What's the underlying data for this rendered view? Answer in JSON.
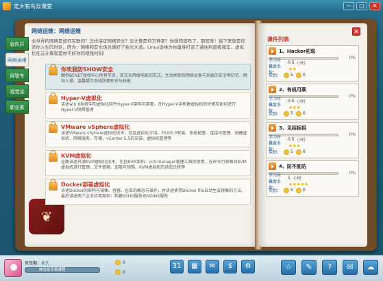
{
  "window": {
    "title": "走大有鸟云课堂",
    "buttons": [
      "—",
      "□",
      "✕"
    ]
  },
  "sidebar": {
    "tabs": [
      {
        "label": "软件开"
      },
      {
        "label": "网络运维"
      },
      {
        "label": "网管专"
      },
      {
        "label": "视觉设"
      },
      {
        "label": "职业素"
      }
    ]
  },
  "left": {
    "header": "网络运维：网络运维",
    "intro": "全世界的网络是如何互联的？怎样保证网络安全？云计算是何方神圣？你想知道吗了，那就来！接下来就是欣赏你入生的时刻，因为：网络和安全场合域好了会光大道，Linux运维为你量身打造了通往利超级我年，虚拟化在云计算就是你不好你的增强时刻！",
    "courses": [
      {
        "name": "你攻我防SHOW安全",
        "desc": "图例BENET授权中心所有学员，首次采用微电影的形式，生动地反映网络设备与系统的安全等防范、网站入侵、温馨提示系统防御知识与技能"
      },
      {
        "name": "Hyper-V虚拟化",
        "desc": "讲述win 8系统中的虚拟化软件Hyper-V架构与部署，在Hyper-V中新建虚拟机的步骤及如何进行Hyper-V快照管理"
      },
      {
        "name": "VMware vSphere虚拟化",
        "desc": "讲述VMware vSphere虚拟化技术，包括虚拟化介绍、ESXi5.5安装、系统配置、连接与管理、创建虚拟机、网络服务、存储，vCenter 5.5的安装，虚拟机管理等"
      },
      {
        "name": "KVM虚拟化",
        "desc": "全面讲述开源KVM虚拟化技术，包括KVM架构、virt-manager管理工具的使用、在命令行界面对KVM虚拟机进行管理、文件管理、克隆与快照、KVM虚拟机的动态迁移等"
      },
      {
        "name": "Docker部署虚拟化",
        "desc": "讲述Docker的架构与镜像、容器、仓库的概念与操作，并讲述使用Docker file自动生成镜像的方法，最后讲述两个企业应用案例：构建SSHD服务与NGINX服务"
      }
    ]
  },
  "right": {
    "title": "课件列表",
    "cards": [
      {
        "title": "1、Hacker初现",
        "percent": "0%",
        "progress": 0,
        "study_label": "学习时长：",
        "study_value": "0.5",
        "study_unit": "小时",
        "diff_label": "难度系数：",
        "stars": "★★",
        "reward_label": "奖励：",
        "reward": "5",
        "extra": "0"
      },
      {
        "title": "2、有机可乘",
        "percent": "0%",
        "progress": 0,
        "study_label": "学习时长：",
        "study_value": "0.5",
        "study_unit": "小时",
        "diff_label": "难度系数：",
        "stars": "★★★",
        "reward_label": "奖励：",
        "reward": "5",
        "extra": "0"
      },
      {
        "title": "3、见招拆招",
        "percent": "0%",
        "progress": 0,
        "study_label": "学习时长：",
        "study_value": "0.5",
        "study_unit": "小时",
        "diff_label": "难度系数：",
        "stars": "★★★",
        "reward_label": "奖励：",
        "reward": "5",
        "extra": "0"
      },
      {
        "title": "4、防不胜防",
        "percent": "0%",
        "progress": 0,
        "study_label": "学习时长：",
        "study_value": "1",
        "study_unit": "小时",
        "diff_label": "难度系数：",
        "stars": "★★★★★",
        "reward_label": "奖励：",
        "reward": "5",
        "extra": "0"
      }
    ]
  },
  "bottom": {
    "expiry_label": "有效期：",
    "expiry_value": "永久",
    "level_text": "体验及专家课程",
    "coins": "0",
    "points": "0"
  }
}
